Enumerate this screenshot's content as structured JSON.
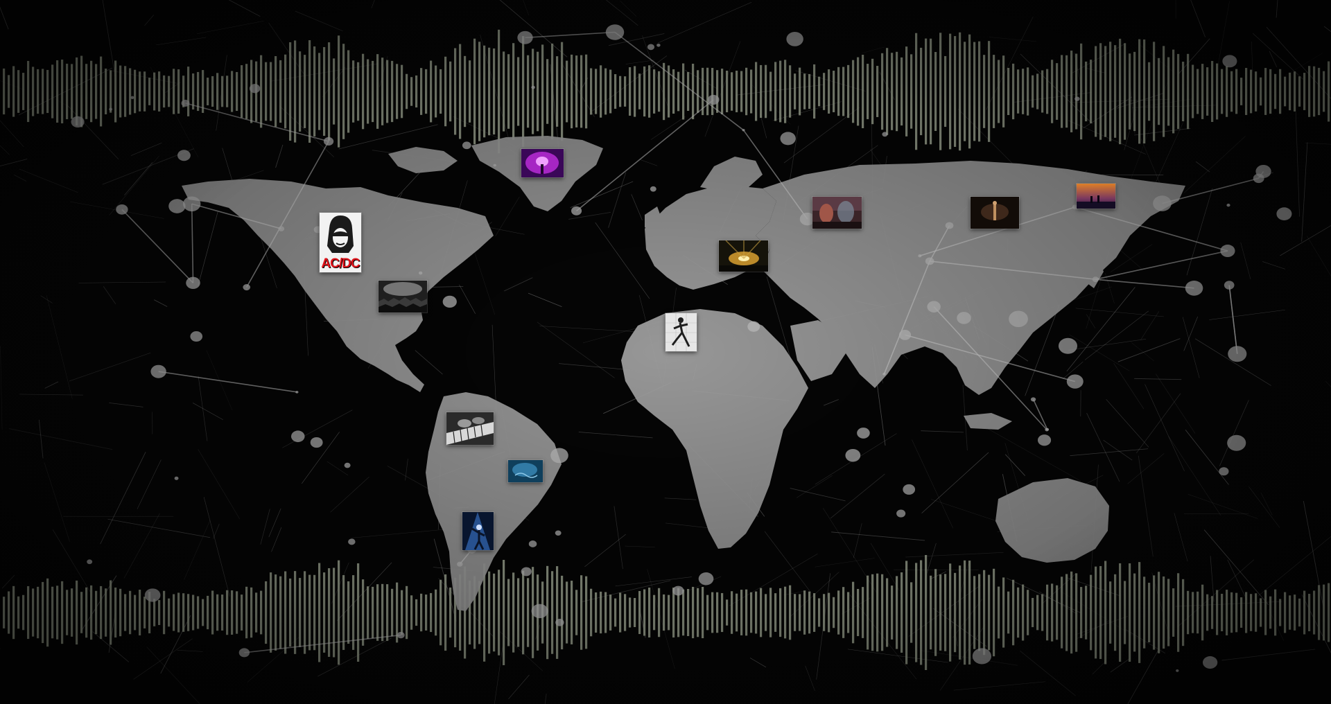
{
  "scene": {
    "title": "",
    "background_color": "#050505",
    "map_color": "#a3a3a3",
    "waveform_color": "#aab39e",
    "network_color": "#d9d9d9"
  },
  "thumbnails": [
    {
      "id": "acdc-poster",
      "description_icon": "poster-icon",
      "label": "AC/DC",
      "colors": [
        "#f2f2f2",
        "#1a1a1a",
        "#d8121b"
      ]
    },
    {
      "id": "concert-crowd-bw",
      "description_icon": "crowd-icon",
      "colors": [
        "#2a2a2a",
        "#9a9a9a"
      ]
    },
    {
      "id": "purple-stage",
      "description_icon": "stage-lights-icon",
      "colors": [
        "#4a0a6a",
        "#c23ad8"
      ]
    },
    {
      "id": "amber-stage-lights",
      "description_icon": "stage-lights-icon",
      "colors": [
        "#2b2410",
        "#d8b040"
      ]
    },
    {
      "id": "dancer-bw",
      "description_icon": "dancer-icon",
      "colors": [
        "#e8e8e8",
        "#222222"
      ]
    },
    {
      "id": "rock-band-red",
      "description_icon": "band-icon",
      "colors": [
        "#3a2628",
        "#b06050"
      ]
    },
    {
      "id": "dark-concert",
      "description_icon": "concert-icon",
      "colors": [
        "#140e0a",
        "#5a4030"
      ]
    },
    {
      "id": "orange-sunset-stage",
      "description_icon": "stage-icon",
      "colors": [
        "#2a1a40",
        "#e08030"
      ]
    },
    {
      "id": "piano-hands-bw",
      "description_icon": "piano-icon",
      "colors": [
        "#303030",
        "#c8c8c8"
      ]
    },
    {
      "id": "blue-underwater",
      "description_icon": "water-icon",
      "colors": [
        "#0c3a5a",
        "#4a9cc8"
      ]
    },
    {
      "id": "blue-performer",
      "description_icon": "performer-icon",
      "colors": [
        "#0a1a3a",
        "#4a8ae0"
      ]
    }
  ]
}
